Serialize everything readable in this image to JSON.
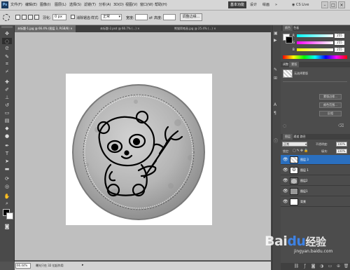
{
  "app": {
    "logo": "Ps"
  },
  "menu": {
    "items": [
      "文件(F)",
      "编辑(E)",
      "图像(I)",
      "图层(L)",
      "选择(S)",
      "滤镜(T)",
      "分析(A)",
      "3D(D)",
      "视图(V)",
      "窗口(W)",
      "帮助(H)"
    ]
  },
  "workspace": {
    "buttons": [
      "基本功能",
      "设计",
      "绘画",
      "»"
    ],
    "active": "基本功能",
    "cslive": "CS Live"
  },
  "options": {
    "feather_label": "羽化:",
    "feather_value": "0 px",
    "antialias_label": "消除锯齿",
    "style_label": "样式:",
    "style_value": "正常",
    "width_label": "宽度:",
    "height_label": "高度:",
    "refine_edge": "调整边缘..."
  },
  "tabs": [
    {
      "label": "未标题-1.jpg @ 66.4% (图层 3, RGB/8)",
      "active": true
    },
    {
      "label": "未标题-2.psd @ 66.7% (...)",
      "active": false
    },
    {
      "label": "熊猫简笔画.jpg @ 25.4% (...)",
      "active": false
    }
  ],
  "status": {
    "zoom": "66.44%",
    "info": "曝光只在 32 位起作用"
  },
  "color_panel": {
    "tabs": [
      "颜色",
      "色板"
    ],
    "sliders": [
      {
        "label": "R",
        "value": "255"
      },
      {
        "label": "G",
        "value": "255"
      },
      {
        "label": "B",
        "value": "255"
      }
    ]
  },
  "styles_panel": {
    "tabs": [
      "调整",
      "蒙版"
    ],
    "title": "无选择蒙版",
    "buttons": [
      "蒙版边缘...",
      "颜色范围...",
      "反相"
    ]
  },
  "layers_panel": {
    "tabs": [
      "图层",
      "通道",
      "路径"
    ],
    "blend_mode": "正常",
    "opacity_label": "不透明度:",
    "opacity_value": "100%",
    "lock_label": "锁定:",
    "fill_label": "填充:",
    "fill_value": "100%",
    "layers": [
      {
        "name": "图层 3",
        "selected": true
      },
      {
        "name": "图层 1",
        "selected": false
      },
      {
        "name": "图层2",
        "selected": false
      },
      {
        "name": "图层1",
        "selected": false
      },
      {
        "name": "背景",
        "selected": false
      }
    ]
  },
  "watermark": {
    "logo": "Bai",
    "paw": "du",
    "text": "经验",
    "url": "jingyan.baidu.com"
  }
}
